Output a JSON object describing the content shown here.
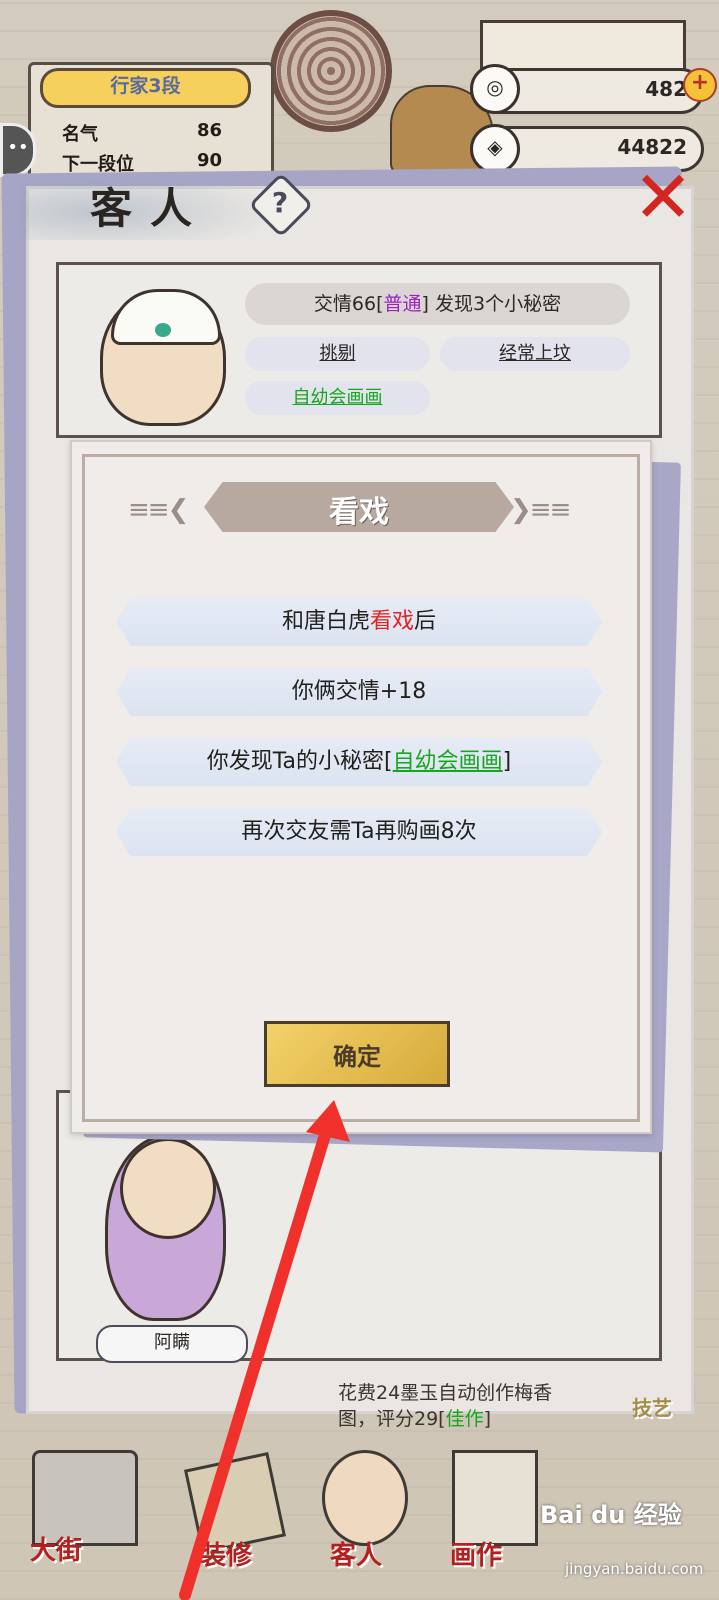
{
  "stats": {
    "rank": "行家3段",
    "rows": [
      {
        "label": "名气",
        "value": "86"
      },
      {
        "label": "下一段位",
        "value": "90"
      }
    ]
  },
  "currency": {
    "jade": "482",
    "coins": "44822"
  },
  "panel": {
    "title": "客人",
    "help_glyph": "?",
    "close_glyph": "✕"
  },
  "guest_card": {
    "info_prefix": "交情66[",
    "info_level": "普通",
    "info_suffix": "] 发现3个小秘密",
    "tags": [
      "挑剔",
      "经常上坟",
      "自幼会画画"
    ],
    "tag_colors": {
      "green": "#17a61f",
      "purple": "#9b22c1"
    }
  },
  "lower_card": {
    "name": "阿瞒"
  },
  "bottom": {
    "note_line1": "花费24墨玉自动创作梅香",
    "note_line2_prefix": "图，评分29[",
    "note_line2_link": "佳作",
    "note_line2_suffix": "]",
    "side_tag": "技艺",
    "nav": [
      "大街",
      "装修",
      "客人",
      "画作"
    ]
  },
  "modal": {
    "title": "看戏",
    "lines": {
      "line1_prefix": "和唐白虎",
      "line1_highlight": "看戏",
      "line1_suffix": "后",
      "line2": "你俩交情+18",
      "line3_prefix": "你发现Ta的小秘密[",
      "line3_link": "自幼会画画",
      "line3_suffix": "]",
      "line4": "再次交友需Ta再购画8次"
    },
    "confirm_label": "确定",
    "accent_red": "#e5201f"
  },
  "watermark": {
    "brand": "Bai du 经验",
    "url": "jingyan.baidu.com"
  }
}
